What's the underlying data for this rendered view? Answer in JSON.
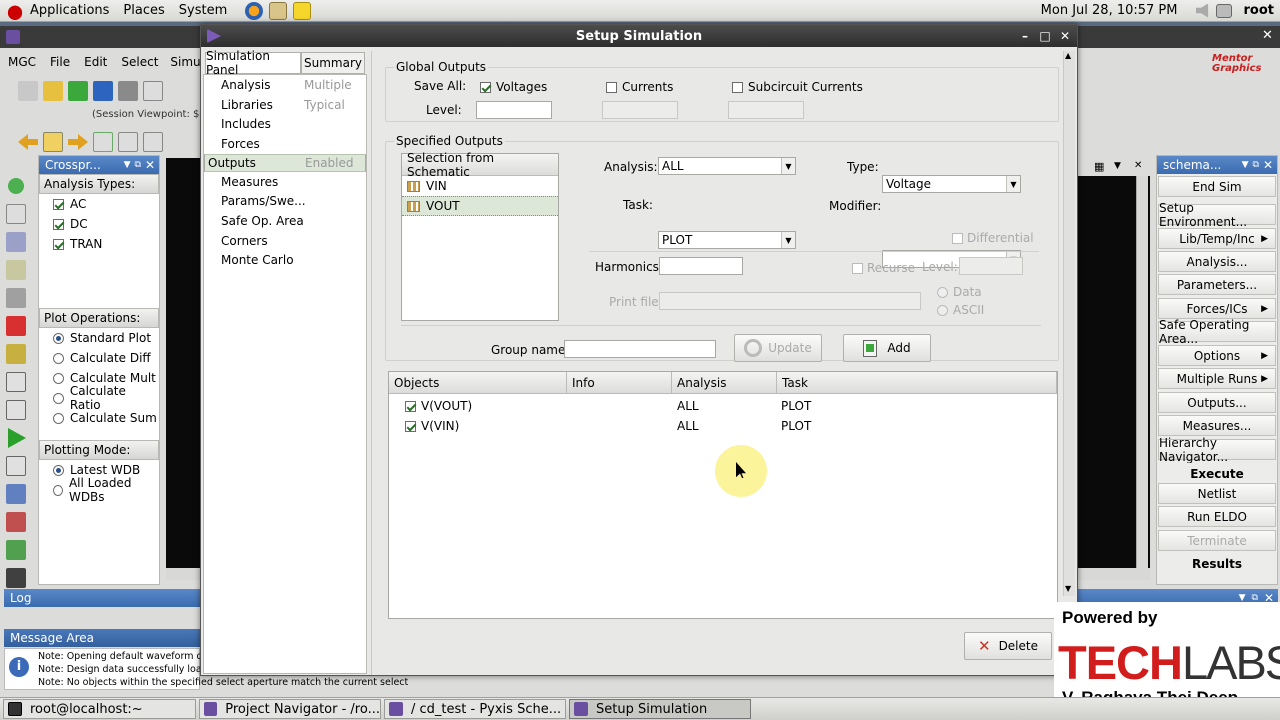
{
  "top_panel": {
    "menus": [
      "Applications",
      "Places",
      "System"
    ],
    "clock": "Mon Jul 28, 10:57 PM",
    "user": "root"
  },
  "taskbar": {
    "tasks": [
      {
        "label": "root@localhost:~",
        "active": false
      },
      {
        "label": "Project Navigator - /ro...",
        "active": false
      },
      {
        "label": "/  cd_test - Pyxis Sche...",
        "active": false
      },
      {
        "label": "Setup Simulation",
        "active": true
      }
    ]
  },
  "mgc": {
    "menus": [
      "MGC",
      "File",
      "Edit",
      "Select",
      "Simulat"
    ],
    "session_text": "(Session Viewpoint: $CO",
    "brand": "Mentor Graphics",
    "crossprobe_title": "Crosspr...",
    "analysis_types_label": "Analysis Types:",
    "analysis_types": [
      {
        "label": "AC",
        "checked": true
      },
      {
        "label": "DC",
        "checked": true
      },
      {
        "label": "TRAN",
        "checked": true
      }
    ],
    "plot_ops_label": "Plot Operations:",
    "plot_ops": [
      {
        "label": "Standard Plot",
        "selected": true
      },
      {
        "label": "Calculate Diff",
        "selected": false
      },
      {
        "label": "Calculate Mult",
        "selected": false
      },
      {
        "label": "Calculate Ratio",
        "selected": false
      },
      {
        "label": "Calculate Sum",
        "selected": false
      }
    ],
    "plotting_mode_label": "Plotting Mode:",
    "plotting_modes": [
      {
        "label": "Latest WDB",
        "selected": true
      },
      {
        "label": "All Loaded WDBs",
        "selected": false
      }
    ],
    "log_title": "Log",
    "message_area_title": "Message Area",
    "messages": [
      "Note: Opening default waveform data",
      "Note: Design data successfully loade",
      "Note: No objects within the specified select aperture match the current selection filter."
    ],
    "schematic_panel_title": "schema...",
    "side_buttons": [
      {
        "label": "End Sim",
        "arrow": false,
        "bold": false,
        "disabled": false
      },
      {
        "label": "Setup Environment...",
        "arrow": false,
        "bold": false,
        "disabled": false
      },
      {
        "label": "Lib/Temp/Inc",
        "arrow": true,
        "bold": false,
        "disabled": false
      },
      {
        "label": "Analysis...",
        "arrow": false,
        "bold": false,
        "disabled": false
      },
      {
        "label": "Parameters...",
        "arrow": false,
        "bold": false,
        "disabled": false
      },
      {
        "label": "Forces/ICs",
        "arrow": true,
        "bold": false,
        "disabled": false
      },
      {
        "label": "Safe Operating Area...",
        "arrow": false,
        "bold": false,
        "disabled": false
      },
      {
        "label": "Options",
        "arrow": true,
        "bold": false,
        "disabled": false
      },
      {
        "label": "Multiple Runs",
        "arrow": true,
        "bold": false,
        "disabled": false
      },
      {
        "label": "Outputs...",
        "arrow": false,
        "bold": false,
        "disabled": false
      },
      {
        "label": "Measures...",
        "arrow": false,
        "bold": false,
        "disabled": false
      },
      {
        "label": "Hierarchy Navigator...",
        "arrow": false,
        "bold": false,
        "disabled": false
      },
      {
        "label": "Execute",
        "arrow": false,
        "bold": true,
        "disabled": false
      },
      {
        "label": "Netlist",
        "arrow": false,
        "bold": false,
        "disabled": false
      },
      {
        "label": "Run ELDO",
        "arrow": false,
        "bold": false,
        "disabled": false
      },
      {
        "label": "Terminate",
        "arrow": false,
        "bold": false,
        "disabled": true
      },
      {
        "label": "Results",
        "arrow": false,
        "bold": true,
        "disabled": false
      }
    ]
  },
  "dialog": {
    "title": "Setup Simulation",
    "tabs": [
      "Simulation Panel",
      "Summary"
    ],
    "nav_items": [
      {
        "label": "Analysis",
        "status": "Multiple",
        "selected": false
      },
      {
        "label": "Libraries",
        "status": "Typical",
        "selected": false
      },
      {
        "label": "Includes",
        "status": "",
        "selected": false
      },
      {
        "label": "Forces",
        "status": "",
        "selected": false
      },
      {
        "label": "Outputs",
        "status": "Enabled",
        "selected": true
      },
      {
        "label": "Measures",
        "status": "",
        "selected": false
      },
      {
        "label": "Params/Swe...",
        "status": "",
        "selected": false
      },
      {
        "label": "Safe Op. Area",
        "status": "",
        "selected": false
      },
      {
        "label": "Corners",
        "status": "",
        "selected": false
      },
      {
        "label": "Monte Carlo",
        "status": "",
        "selected": false
      }
    ],
    "global_outputs": {
      "group_label": "Global Outputs",
      "save_all_label": "Save All:",
      "voltages": {
        "label": "Voltages",
        "checked": true
      },
      "currents": {
        "label": "Currents",
        "checked": false
      },
      "subcircuit_currents": {
        "label": "Subcircuit Currents",
        "checked": false
      },
      "level_label": "Level:",
      "level_value": ""
    },
    "specified_outputs": {
      "group_label": "Specified Outputs",
      "list_header": "Selection from Schematic",
      "list_items": [
        {
          "label": "VIN",
          "selected": false
        },
        {
          "label": "VOUT",
          "selected": true
        }
      ],
      "analysis_label": "Analysis:",
      "analysis_value": "ALL",
      "type_label": "Type:",
      "type_value": "Voltage",
      "task_label": "Task:",
      "task_value": "PLOT",
      "modifier_label": "Modifier:",
      "modifier_value": "",
      "differential_label": "Differential",
      "harmonics_label": "Harmonics:",
      "harmonics_value": "",
      "recurse_label": "Recurse",
      "level_label": "Level:",
      "print_file_label": "Print file:",
      "data_label": "Data",
      "ascii_label": "ASCII",
      "group_name_label": "Group name:",
      "group_name_value": "",
      "update_label": "Update",
      "add_label": "Add"
    },
    "table": {
      "columns": [
        "Objects",
        "Info",
        "Analysis",
        "Task"
      ],
      "rows": [
        {
          "object": "V(VOUT)",
          "info": "",
          "analysis": "ALL",
          "task": "PLOT",
          "checked": true
        },
        {
          "object": "V(VIN)",
          "info": "",
          "analysis": "ALL",
          "task": "PLOT",
          "checked": true
        }
      ]
    },
    "delete_label": "Delete"
  },
  "watermark": {
    "powered_by": "Powered by",
    "brand_left": "TECH",
    "brand_right": "LABS",
    "author": "V. Raghava Thej Deep"
  },
  "colors": {
    "title_blue": "#3b6cb0",
    "selection_green": "#dde7d8",
    "delete_red": "#c0392b",
    "watermark_red": "#d21d1d"
  }
}
